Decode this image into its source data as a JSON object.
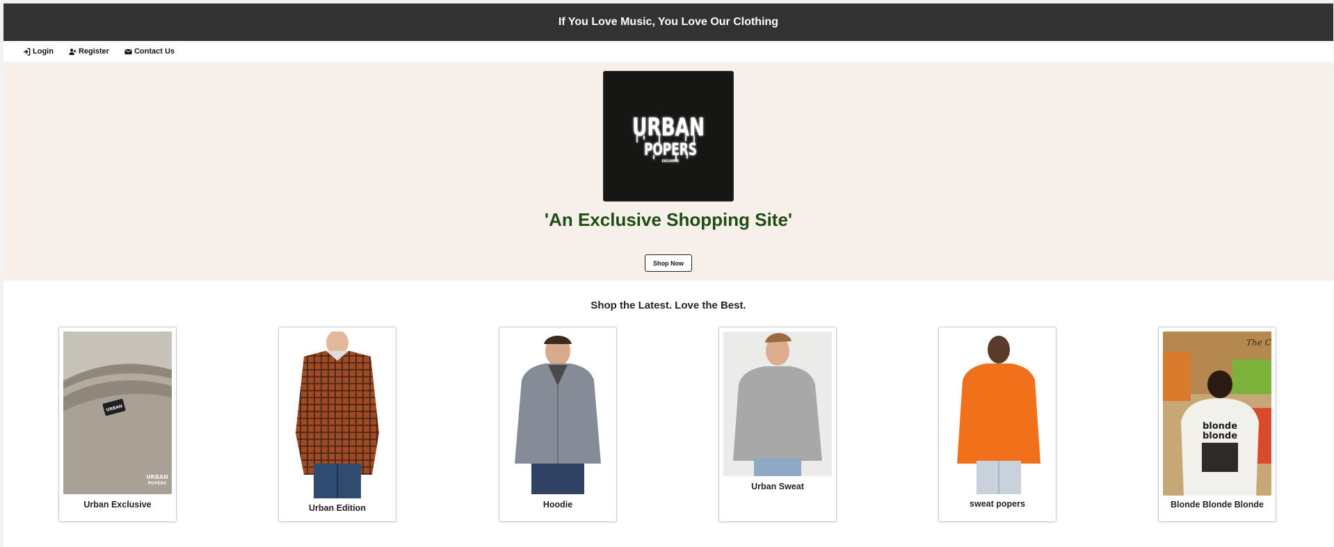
{
  "header": {
    "title": "If You Love Music, You Love Our Clothing"
  },
  "nav": {
    "items": [
      {
        "label": "Login",
        "icon": "login-icon"
      },
      {
        "label": "Register",
        "icon": "register-icon"
      },
      {
        "label": "Contact Us",
        "icon": "envelope-icon"
      }
    ]
  },
  "hero": {
    "logo_text_line1": "URBAN",
    "logo_text_line2": "POPERS",
    "logo_text_line3": "EXCLUSIVE",
    "tagline": "'An Exclusive Shopping Site'",
    "button_label": "Shop Now"
  },
  "products": {
    "heading": "Shop the Latest. Love the Best.",
    "items": [
      {
        "name": "Urban Exclusive"
      },
      {
        "name": "Urban Edition"
      },
      {
        "name": "Hoodie"
      },
      {
        "name": "Urban Sweat"
      },
      {
        "name": "sweat popers"
      },
      {
        "name": "Blonde Blonde Blonde"
      }
    ]
  },
  "colors": {
    "topbar": "#333333",
    "hero_bg": "#f7efea",
    "tagline": "#1f4d14"
  }
}
